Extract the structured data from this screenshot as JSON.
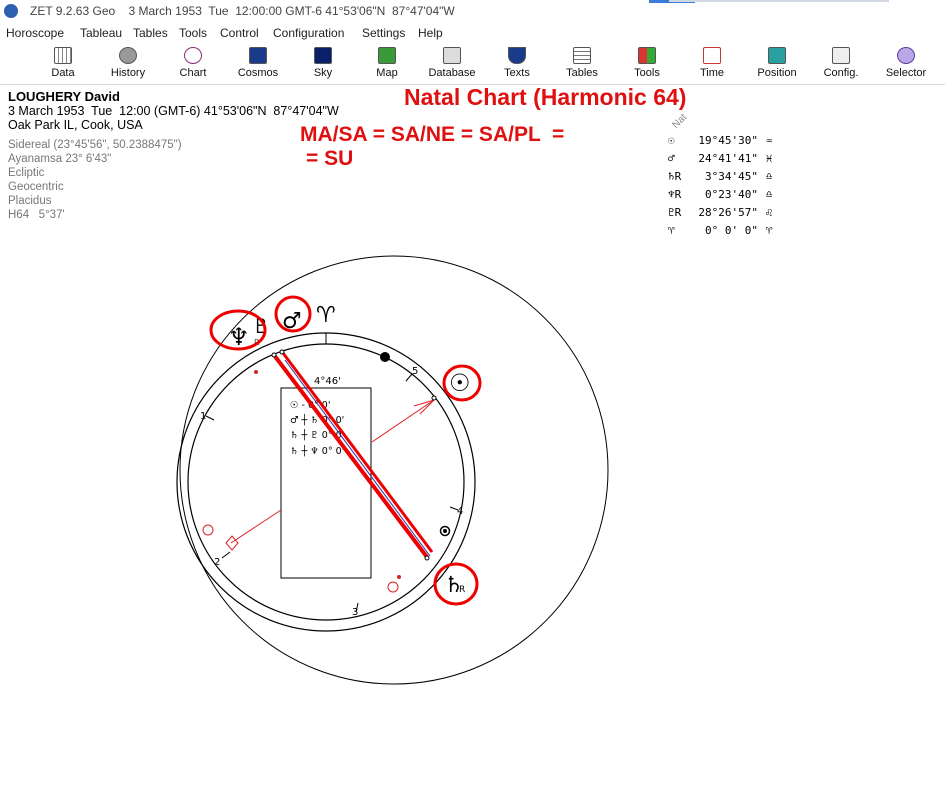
{
  "window": {
    "title": "ZET 9.2.63 Geo    3 March 1953  Tue  12:00:00 GMT-6 41°53'06\"N  87°47'04\"W"
  },
  "menu": [
    "Horoscope",
    "Tableau",
    "Tables",
    "Tools",
    "Control",
    "Configuration",
    "Settings",
    "Help"
  ],
  "toolbar": [
    {
      "label": "Data",
      "icon": "data-icon"
    },
    {
      "label": "History",
      "icon": "history-icon"
    },
    {
      "label": "Chart",
      "icon": "chart-icon"
    },
    {
      "label": "Cosmos",
      "icon": "cosmos-icon"
    },
    {
      "label": "Sky",
      "icon": "sky-icon"
    },
    {
      "label": "Map",
      "icon": "map-icon"
    },
    {
      "label": "Database",
      "icon": "database-icon"
    },
    {
      "label": "Texts",
      "icon": "texts-icon"
    },
    {
      "label": "Tables",
      "icon": "tables-icon"
    },
    {
      "label": "Tools",
      "icon": "tools-icon"
    },
    {
      "label": "Time",
      "icon": "time-icon"
    },
    {
      "label": "Position",
      "icon": "position-icon"
    },
    {
      "label": "Config.",
      "icon": "config-icon"
    },
    {
      "label": "Selector",
      "icon": "selector-icon"
    }
  ],
  "chart_info": {
    "name": "LOUGHERY David",
    "datetime": "3 March 1953  Tue  12:00 (GMT-6) 41°53'06\"N  87°47'04\"W",
    "place": "Oak Park IL, Cook, USA",
    "zodiac": "Sidereal (23°45'56\", 50.2388475\")",
    "ayanamsa": "Ayanamsa 23° 6'43\"",
    "coords": "Ecliptic",
    "center": "Geocentric",
    "houses": "Placidus",
    "harmonic": "H64   5°37'"
  },
  "annotations": {
    "title": "Natal Chart (Harmonic 64)",
    "formula_line1": "MA/SA = SA/NE = SA/PL  =",
    "formula_line2": "= SU"
  },
  "nat_label": "Nat",
  "positions": [
    {
      "glyph": "☉",
      "value": "19°45'30\"",
      "sign": "♒"
    },
    {
      "glyph": "♂",
      "value": "24°41'41\"",
      "sign": "♓"
    },
    {
      "glyph": "♄R",
      "value": "3°34'45\"",
      "sign": "♎"
    },
    {
      "glyph": "♆R",
      "value": "0°23'40\"",
      "sign": "♎"
    },
    {
      "glyph": "♇R",
      "value": "28°26'57\"",
      "sign": "♌"
    },
    {
      "glyph": "♈",
      "value": "0° 0' 0\"",
      "sign": "♈"
    }
  ],
  "wheel": {
    "inner_box_top": "4°46'",
    "inner_box_rows": [
      "☉ - 0° 0'",
      "♂ ┼ ♄ 0° 0'",
      "♄ ┼ ♇ 0° 0'",
      "♄ ┼ ♆ 0° 0'"
    ],
    "planet_glyphs": {
      "neptune": "♆",
      "pluto": "♇",
      "mars": "♂",
      "aries": "♈",
      "sun": "☉",
      "saturn": "♄",
      "retro": "R"
    },
    "house_numbers": [
      "1",
      "2",
      "3",
      "4",
      "5"
    ]
  },
  "colors": {
    "annotation_red": "#e01010",
    "axis_line": "#cc0000"
  }
}
